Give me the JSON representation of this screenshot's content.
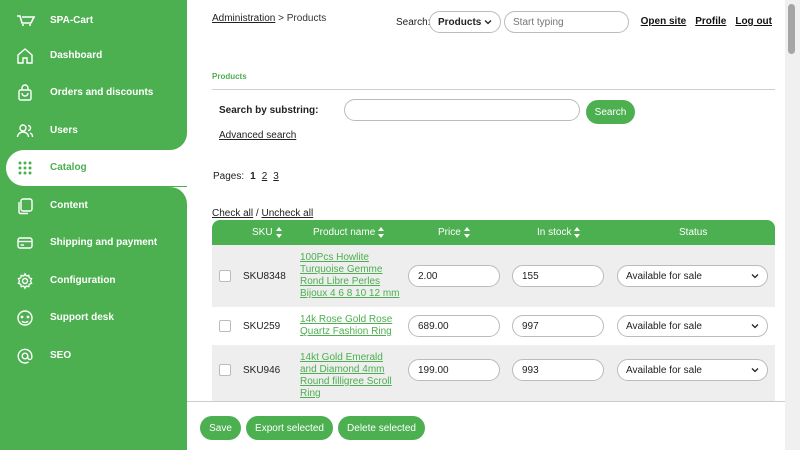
{
  "sidebar": {
    "brand": "SPA-Cart",
    "items": [
      {
        "label": "Dashboard",
        "icon": "home-icon"
      },
      {
        "label": "Orders and discounts",
        "icon": "shopping-bag-icon"
      },
      {
        "label": "Users",
        "icon": "users-icon"
      },
      {
        "label": "Catalog",
        "icon": "grid-dots-icon",
        "active": true
      },
      {
        "label": "Content",
        "icon": "pages-icon"
      },
      {
        "label": "Shipping and payment",
        "icon": "credit-card-icon"
      },
      {
        "label": "Configuration",
        "icon": "gear-icon"
      },
      {
        "label": "Support desk",
        "icon": "support-icon"
      },
      {
        "label": "SEO",
        "icon": "at-sign-icon"
      }
    ]
  },
  "header": {
    "breadcrumb_link": "Administration",
    "breadcrumb_current": " > Products",
    "search_label": "Search:",
    "search_scope": "Products",
    "search_placeholder": "Start typing",
    "links": {
      "open_site": "Open site",
      "profile": "Profile",
      "logout": "Log out"
    }
  },
  "section": {
    "title": "Products",
    "substring_label": "Search by substring:",
    "substring_value": "",
    "search_button": "Search",
    "advanced_search": "Advanced search"
  },
  "pagination": {
    "label": "Pages:",
    "current": "1",
    "pages": [
      "2",
      "3"
    ]
  },
  "selection": {
    "check_all": "Check all",
    "separator": " / ",
    "uncheck_all": "Uncheck all"
  },
  "table": {
    "columns": {
      "sku": "SKU",
      "name": "Product name",
      "price": "Price",
      "stock": "In stock",
      "status": "Status"
    },
    "rows": [
      {
        "sku": "SKU8348",
        "name": "100Pcs Howlite Turquoise Gemme Rond Libre Perles Bijoux 4 6 8 10 12 mm",
        "price": "2.00",
        "stock": "155",
        "status": "Available for sale"
      },
      {
        "sku": "SKU259",
        "name": "14k Rose Gold Rose Quartz Fashion Ring",
        "price": "689.00",
        "stock": "997",
        "status": "Available for sale"
      },
      {
        "sku": "SKU946",
        "name": "14kt Gold Emerald and Diamond 4mm Round filligree Scroll Ring",
        "price": "199.00",
        "stock": "993",
        "status": "Available for sale"
      }
    ]
  },
  "footer": {
    "save": "Save",
    "export": "Export selected",
    "delete": "Delete selected"
  },
  "colors": {
    "accent": "#4caf50",
    "row_alt": "#eeeeee"
  }
}
